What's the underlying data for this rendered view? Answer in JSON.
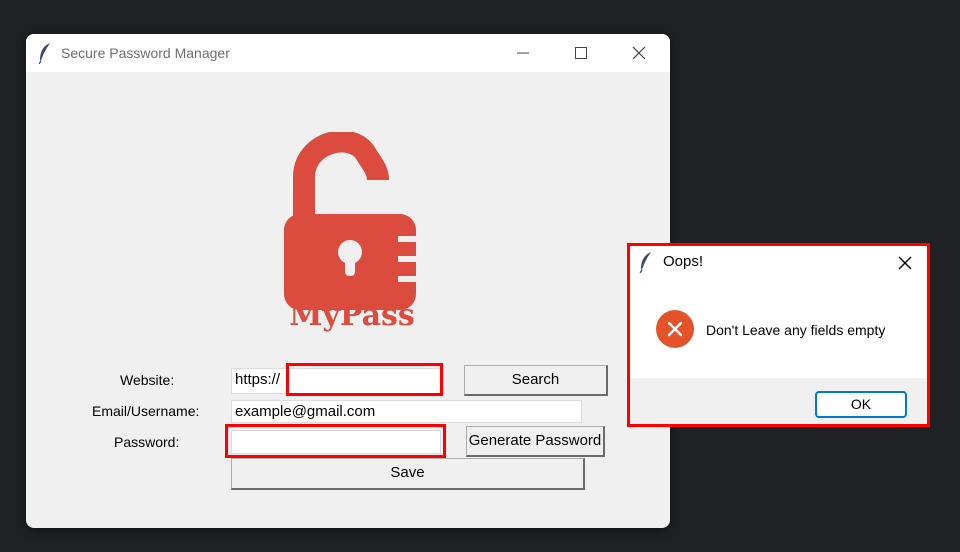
{
  "window": {
    "title": "Secure Password Manager",
    "logo_text": "MyPass",
    "logo_color": "#db4b3e"
  },
  "form": {
    "website_label": "Website:",
    "website_value": "https://",
    "email_label": "Email/Username:",
    "email_value": "example@gmail.com",
    "password_label": "Password:",
    "password_value": "",
    "search_button": "Search",
    "generate_button": "Generate Password",
    "save_button": "Save"
  },
  "dialog": {
    "title": "Oops!",
    "message": "Don't Leave any fields empty",
    "ok_button": "OK",
    "icon": "error-icon"
  },
  "highlight_color": "#ff0000"
}
